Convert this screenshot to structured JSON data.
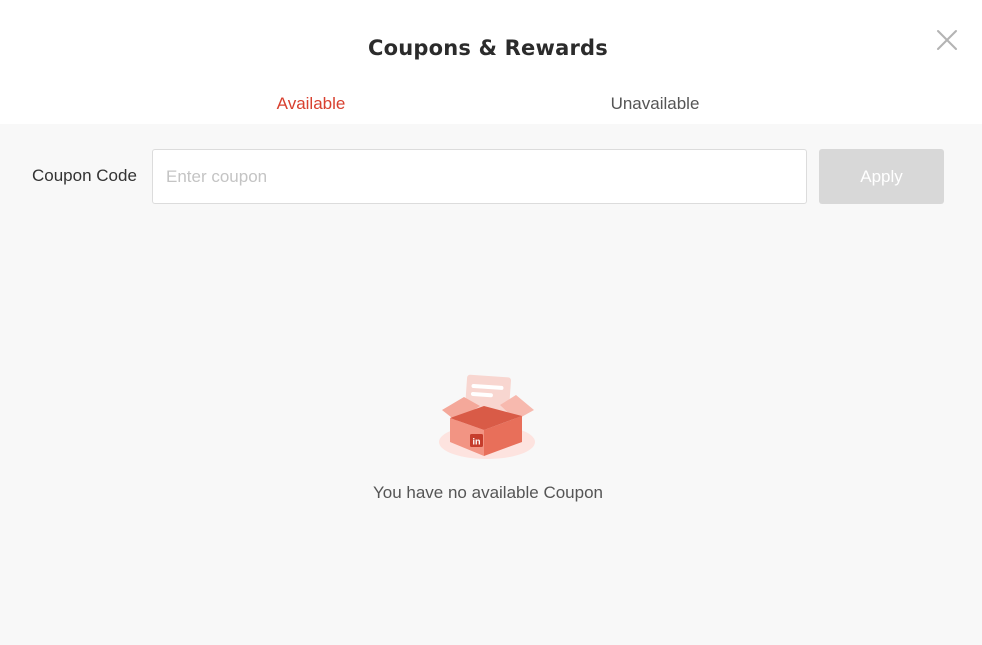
{
  "modal": {
    "title": "Coupons & Rewards",
    "close_icon": "close-icon"
  },
  "tabs": [
    {
      "label": "Available",
      "active": true
    },
    {
      "label": "Unavailable",
      "active": false
    }
  ],
  "coupon_form": {
    "label": "Coupon Code",
    "input_value": "",
    "input_placeholder": "Enter coupon",
    "apply_label": "Apply"
  },
  "empty_state": {
    "icon": "empty-gift-box-icon",
    "message": "You have no available Coupon",
    "box_badge": "in"
  },
  "colors": {
    "accent": "#d8402f",
    "content_bg": "#f8f8f8",
    "button_disabled_bg": "#d8d8d8",
    "box_main": "#e86f5a",
    "box_light": "#f4a89a",
    "shadow": "#fde3df"
  }
}
